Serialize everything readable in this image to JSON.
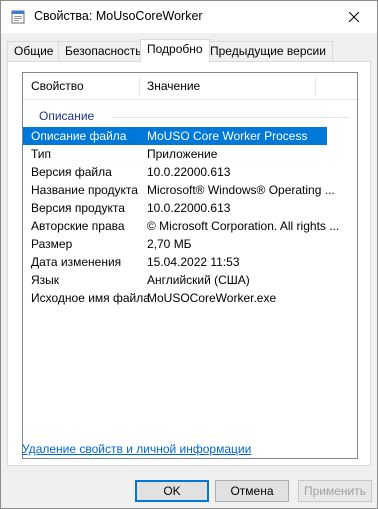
{
  "window": {
    "title": "Свойства: MoUsoCoreWorker"
  },
  "tabs": [
    {
      "label": "Общие"
    },
    {
      "label": "Безопасность"
    },
    {
      "label": "Подробно"
    },
    {
      "label": "Предыдущие версии"
    }
  ],
  "listview": {
    "col_property": "Свойство",
    "col_value": "Значение",
    "group": "Описание",
    "rows": [
      {
        "key": "Описание файла",
        "value": "MoUSO Core Worker Process"
      },
      {
        "key": "Тип",
        "value": "Приложение"
      },
      {
        "key": "Версия файла",
        "value": "10.0.22000.613"
      },
      {
        "key": "Название продукта",
        "value": "Microsoft® Windows® Operating ..."
      },
      {
        "key": "Версия продукта",
        "value": "10.0.22000.613"
      },
      {
        "key": "Авторские права",
        "value": "© Microsoft Corporation. All rights ..."
      },
      {
        "key": "Размер",
        "value": "2,70 МБ"
      },
      {
        "key": "Дата изменения",
        "value": "15.04.2022 11:53"
      },
      {
        "key": "Язык",
        "value": "Английский (США)"
      },
      {
        "key": "Исходное имя файла",
        "value": "MoUSOCoreWorker.exe"
      }
    ]
  },
  "link": "Удаление свойств и личной информации",
  "buttons": {
    "ok": "OK",
    "cancel": "Отмена",
    "apply": "Применить"
  },
  "colors": {
    "accent": "#0078d7",
    "link": "#0066cc",
    "group": "#1e3287"
  },
  "icons": {
    "app": "file-icon",
    "close": "close-icon"
  }
}
